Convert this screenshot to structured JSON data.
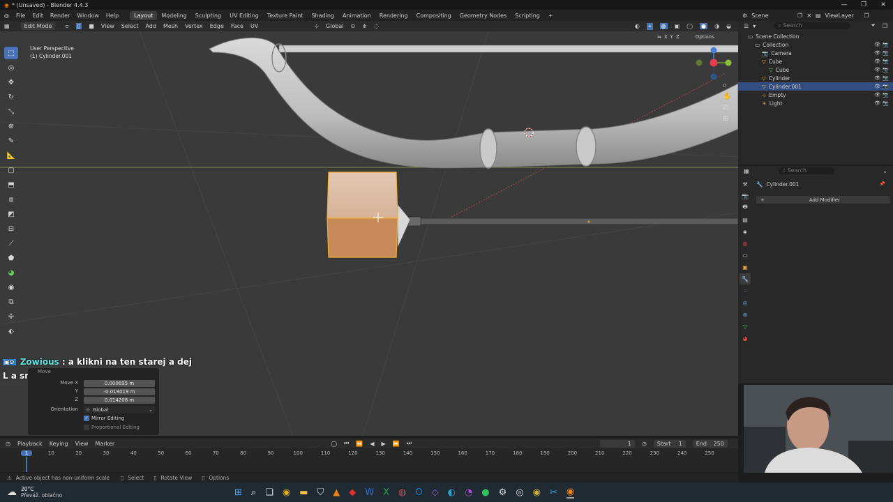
{
  "window": {
    "title": "* (Unsaved) - Blender 4.4.3",
    "controls": [
      "—",
      "❐",
      "✕"
    ]
  },
  "menu": [
    "File",
    "Edit",
    "Render",
    "Window",
    "Help"
  ],
  "workspaces": [
    "Layout",
    "Modeling",
    "Sculpting",
    "UV Editing",
    "Texture Paint",
    "Shading",
    "Animation",
    "Rendering",
    "Compositing",
    "Geometry Nodes",
    "Scripting",
    "+"
  ],
  "active_workspace": "Layout",
  "scene": {
    "scene_name": "Scene",
    "view_layer": "ViewLayer"
  },
  "viewport_header": {
    "mode": "Edit Mode",
    "menus": [
      "View",
      "Select",
      "Add",
      "Mesh",
      "Vertex",
      "Edge",
      "Face",
      "UV"
    ],
    "orientation": "Global",
    "options": "Options",
    "axes": [
      "X",
      "Y",
      "Z"
    ]
  },
  "viewport": {
    "perspective": "User Perspective",
    "object_label": "(1) Cylinder.001"
  },
  "outliner": {
    "search_placeholder": "Search",
    "items": [
      {
        "name": "Scene Collection",
        "indent": 0
      },
      {
        "name": "Collection",
        "indent": 1
      },
      {
        "name": "Camera",
        "indent": 2
      },
      {
        "name": "Cube",
        "indent": 2
      },
      {
        "name": "Cube",
        "indent": 3
      },
      {
        "name": "Cylinder",
        "indent": 2
      },
      {
        "name": "Cylinder.001",
        "indent": 2,
        "selected": true
      },
      {
        "name": "Empty",
        "indent": 2
      },
      {
        "name": "Light",
        "indent": 2
      }
    ]
  },
  "properties": {
    "search_placeholder": "Search",
    "object_name": "Cylinder.001",
    "add_modifier": "Add Modifier"
  },
  "operator_panel": {
    "title": "Move",
    "fields": [
      {
        "label": "Move X",
        "value": "0.000695 m"
      },
      {
        "label": "Y",
        "value": "-0.019019 m"
      },
      {
        "label": "Z",
        "value": "0.014208 m"
      }
    ],
    "orientation_label": "Orientation",
    "orientation_value": "Global",
    "mirror_editing": "Mirror Editing",
    "proportional_editing": "Proportional Editing"
  },
  "chat": {
    "user": "Zowious",
    "line1": ": a klikni na ten starej a dej",
    "line2": "L a smaž ho at ti neprekáž"
  },
  "timeline": {
    "menus": [
      "Playback",
      "Keying",
      "View",
      "Marker"
    ],
    "current_frame": "1",
    "start_label": "Start",
    "start": "1",
    "end_label": "End",
    "end": "250",
    "ticks": [
      "1",
      "10",
      "20",
      "30",
      "40",
      "50",
      "60",
      "70",
      "80",
      "90",
      "100",
      "110",
      "120",
      "130",
      "140",
      "150",
      "160",
      "170",
      "180",
      "190",
      "200",
      "210",
      "220",
      "230",
      "240",
      "250"
    ]
  },
  "statusbar": {
    "message": "Active object has non-uniform scale",
    "items": [
      "Select",
      "Rotate View",
      "Options"
    ]
  },
  "taskbar": {
    "temperature": "20°C",
    "weather": "Převáž. oblačno"
  },
  "colors": {
    "selected_face": "#c8895a",
    "active_tool": "#4772b3",
    "outliner_selected": "#334d80",
    "chat_name": "#66e0e0"
  }
}
